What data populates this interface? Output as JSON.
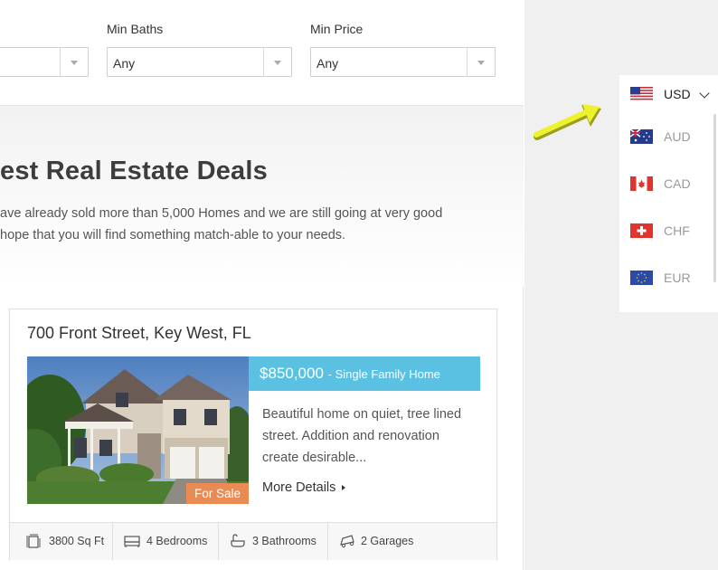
{
  "filters": {
    "min_baths_label": "Min Baths",
    "min_price_label": "Min Price",
    "min_baths_value": "Any",
    "min_price_value": "Any"
  },
  "hero": {
    "title": "est Real Estate Deals",
    "line1": "ave already sold more than 5,000 Homes and we are still going at very good",
    "line2": "hope that you will find something match-able to your needs."
  },
  "listing": {
    "address": "700 Front Street, Key West, FL",
    "price": "$850,000",
    "type": "- Single Family Home",
    "status_badge": "For Sale",
    "description_lines": [
      "Beautiful home on quiet, tree lined",
      "street. Addition and renovation",
      "create desirable..."
    ],
    "more_details": "More Details",
    "stats": {
      "area": "3800 Sq Ft",
      "bedrooms": "4 Bedrooms",
      "bathrooms": "3 Bathrooms",
      "garages": "2 Garages"
    }
  },
  "currency_switcher": {
    "selected": "USD",
    "options": [
      "AUD",
      "CAD",
      "CHF",
      "EUR"
    ]
  },
  "colors": {
    "price_bar": "#5bc1e2",
    "badge": "#e98b52",
    "arrow": "#e6ee2b"
  }
}
